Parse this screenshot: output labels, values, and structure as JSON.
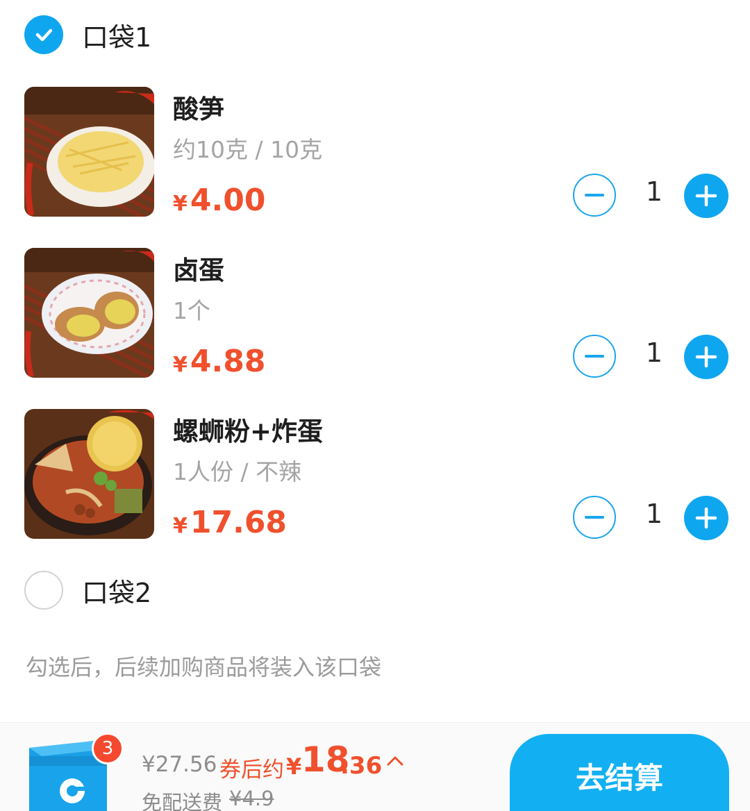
{
  "bags": [
    {
      "title": "口袋1",
      "checked": true
    },
    {
      "title": "口袋2",
      "checked": false
    }
  ],
  "items": [
    {
      "name": "酸笋",
      "spec": "约10克 / 10克",
      "currency": "¥",
      "price": "4.00",
      "qty": "1",
      "image": "pickled-bamboo-shoots"
    },
    {
      "name": "卤蛋",
      "spec": "1个",
      "currency": "¥",
      "price": "4.88",
      "qty": "1",
      "image": "braised-egg"
    },
    {
      "name": "螺蛳粉+炸蛋",
      "spec": "1人份 / 不辣",
      "currency": "¥",
      "price": "17.68",
      "qty": "1",
      "image": "snail-noodles"
    }
  ],
  "hint": "勾选后，后续加购商品将装入该口袋",
  "cart": {
    "badge": "3",
    "original_total": "¥27.56",
    "after_coupon_label": "券后约",
    "estimate_currency": "¥",
    "estimate_int": "18",
    "estimate_dec": ".36",
    "free_delivery_label": "免配送费",
    "delivery_original": "¥4.9",
    "checkout_label": "去结算"
  },
  "colors": {
    "accent_blue": "#0fa6f0",
    "price_red": "#f0502d",
    "badge_red": "#f4492f"
  }
}
